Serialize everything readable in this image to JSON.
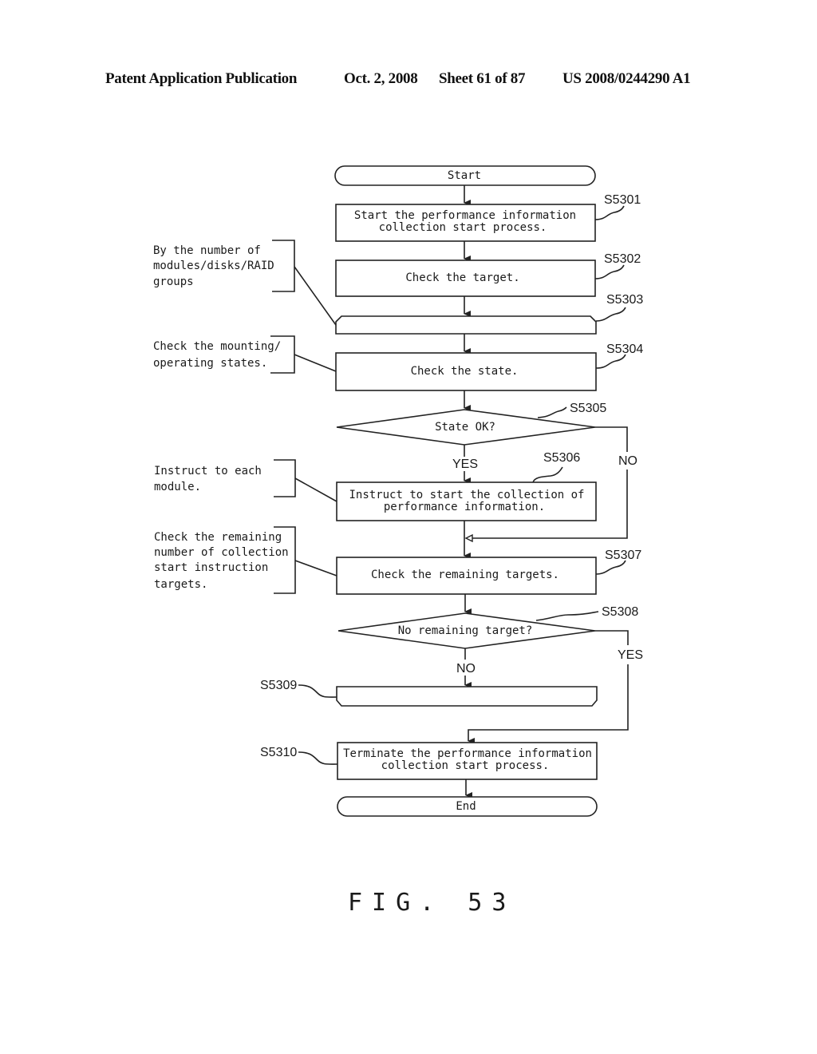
{
  "header": {
    "publication": "Patent Application Publication",
    "date": "Oct. 2, 2008",
    "sheet": "Sheet 61 of 87",
    "number": "US 2008/0244290 A1"
  },
  "flowchart": {
    "start": "Start",
    "end": "End",
    "steps": {
      "s5301": {
        "id": "S5301",
        "lines": [
          "Start the performance information",
          "collection start process."
        ]
      },
      "s5302": {
        "id": "S5302",
        "lines": [
          "Check the target."
        ]
      },
      "s5303": {
        "id": "S5303",
        "lines": []
      },
      "s5304": {
        "id": "S5304",
        "lines": [
          "Check the state."
        ]
      },
      "s5305": {
        "id": "S5305",
        "lines": [
          "State OK?"
        ],
        "yes": "YES",
        "no": "NO"
      },
      "s5306": {
        "id": "S5306",
        "lines": [
          "Instruct to start the collection of",
          "performance information."
        ]
      },
      "s5307": {
        "id": "S5307",
        "lines": [
          "Check the remaining targets."
        ]
      },
      "s5308": {
        "id": "S5308",
        "lines": [
          "No remaining target?"
        ],
        "yes": "YES",
        "no": "NO"
      },
      "s5309": {
        "id": "S5309",
        "lines": []
      },
      "s5310": {
        "id": "S5310",
        "lines": [
          "Terminate the performance information",
          "collection start process."
        ]
      }
    },
    "annotations": [
      {
        "lines": [
          "By the number of",
          "modules/disks/RAID",
          "groups"
        ]
      },
      {
        "lines": [
          "Check the mounting/",
          "operating states."
        ]
      },
      {
        "lines": [
          "Instruct to each",
          "module."
        ]
      },
      {
        "lines": [
          "Check the remaining",
          "number of collection",
          "start instruction",
          "targets."
        ]
      }
    ]
  },
  "figure_label": "FIG. 53"
}
